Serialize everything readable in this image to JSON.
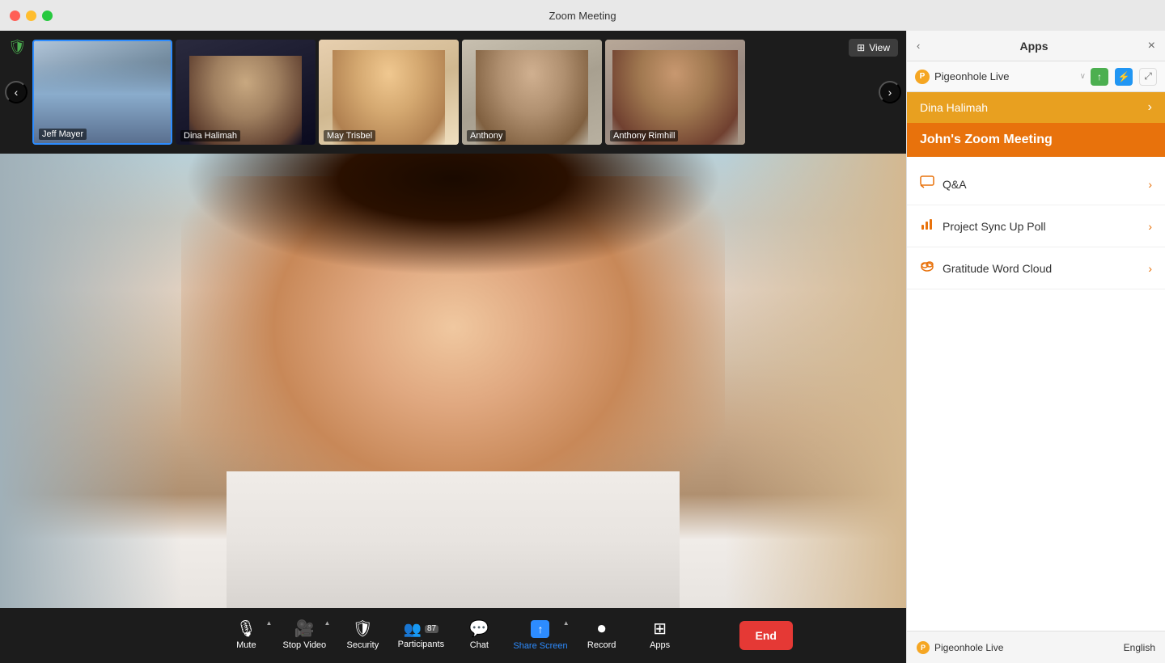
{
  "titleBar": {
    "title": "Zoom Meeting"
  },
  "thumbnails": [
    {
      "name": "Jeff Mayer",
      "active": true,
      "colorClass": "thumb-jeff"
    },
    {
      "name": "Dina Halimah",
      "active": false,
      "colorClass": "thumb-dina"
    },
    {
      "name": "May Trisbel",
      "active": false,
      "colorClass": "thumb-may"
    },
    {
      "name": "Anthony",
      "active": false,
      "colorClass": "thumb-anthony"
    },
    {
      "name": "Anthony Rimhill",
      "active": false,
      "colorClass": "thumb-rimhill"
    }
  ],
  "viewButton": "View",
  "toolbar": {
    "mute": "Mute",
    "stopVideo": "Stop Video",
    "security": "Security",
    "participants": "Participants",
    "participantsCount": "87",
    "chat": "Chat",
    "shareScreen": "Share Screen",
    "record": "Record",
    "apps": "Apps",
    "end": "End"
  },
  "rightPanel": {
    "title": "Apps",
    "closeLabel": "×",
    "chevronLeft": "‹",
    "pigeonholeLabel": "Pigeonhole Live",
    "pigeonholeChevron": "∨",
    "dinaLabel": "Dina Halimah",
    "dinaArrow": "›",
    "meetingTitle": "John's Zoom Meeting",
    "menuItems": [
      {
        "icon": "📋",
        "label": "Q&A"
      },
      {
        "icon": "📊",
        "label": "Project Sync Up Poll"
      },
      {
        "icon": "☁",
        "label": "Gratitude Word Cloud"
      }
    ],
    "bottomLabel": "Pigeonhole Live",
    "bottomLang": "English"
  }
}
